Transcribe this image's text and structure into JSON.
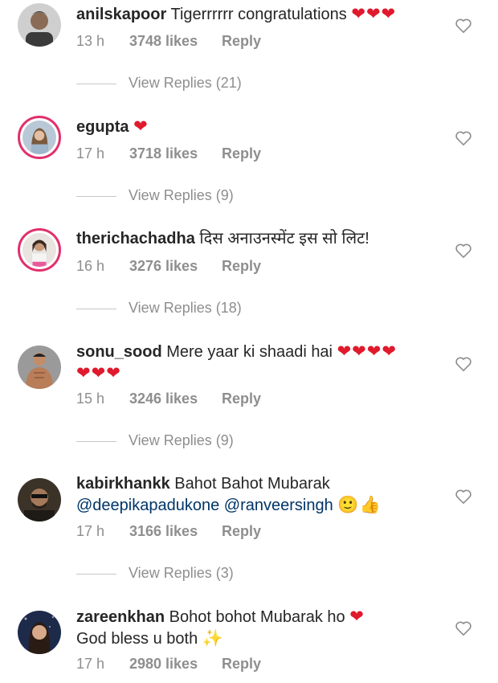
{
  "colors": {
    "heart": "#e0192c",
    "mention": "#003569",
    "meta": "#8e8e8e",
    "story_ring": "#e1306c"
  },
  "comments": [
    {
      "username": "anilskapoor",
      "text": "Tigerrrrrr congratulations",
      "emoji": "❤❤❤",
      "time": "13 h",
      "likes": "3748 likes",
      "reply": "Reply",
      "view_replies": "View Replies (21)"
    },
    {
      "username": "egupta",
      "text": "",
      "emoji": "❤",
      "time": "17 h",
      "likes": "3718 likes",
      "reply": "Reply",
      "view_replies": "View Replies (9)"
    },
    {
      "username": "therichachadha",
      "text": "दिस अनाउनस्मेंट इस सो लिट!",
      "emoji": "",
      "time": "16 h",
      "likes": "3276 likes",
      "reply": "Reply",
      "view_replies": "View Replies (18)"
    },
    {
      "username": "sonu_sood",
      "text": "Mere yaar ki shaadi hai",
      "emoji": "❤❤❤❤",
      "emoji_line2": "❤❤❤",
      "time": "15 h",
      "likes": "3246 likes",
      "reply": "Reply",
      "view_replies": "View Replies (9)"
    },
    {
      "username": "kabirkhankk",
      "text": "Bahot Bahot Mubarak",
      "mention1": "@deepikapadukone",
      "mention2": "@ranveersingh",
      "emoji": "🙂👍",
      "time": "17 h",
      "likes": "3166 likes",
      "reply": "Reply",
      "view_replies": "View Replies (3)"
    },
    {
      "username": "zareenkhan",
      "text": "Bohot bohot Mubarak ho",
      "emoji": "❤",
      "text_line2": "God bless u both",
      "emoji_line2": "✨",
      "time": "17 h",
      "likes": "2980 likes",
      "reply": "Reply"
    }
  ]
}
